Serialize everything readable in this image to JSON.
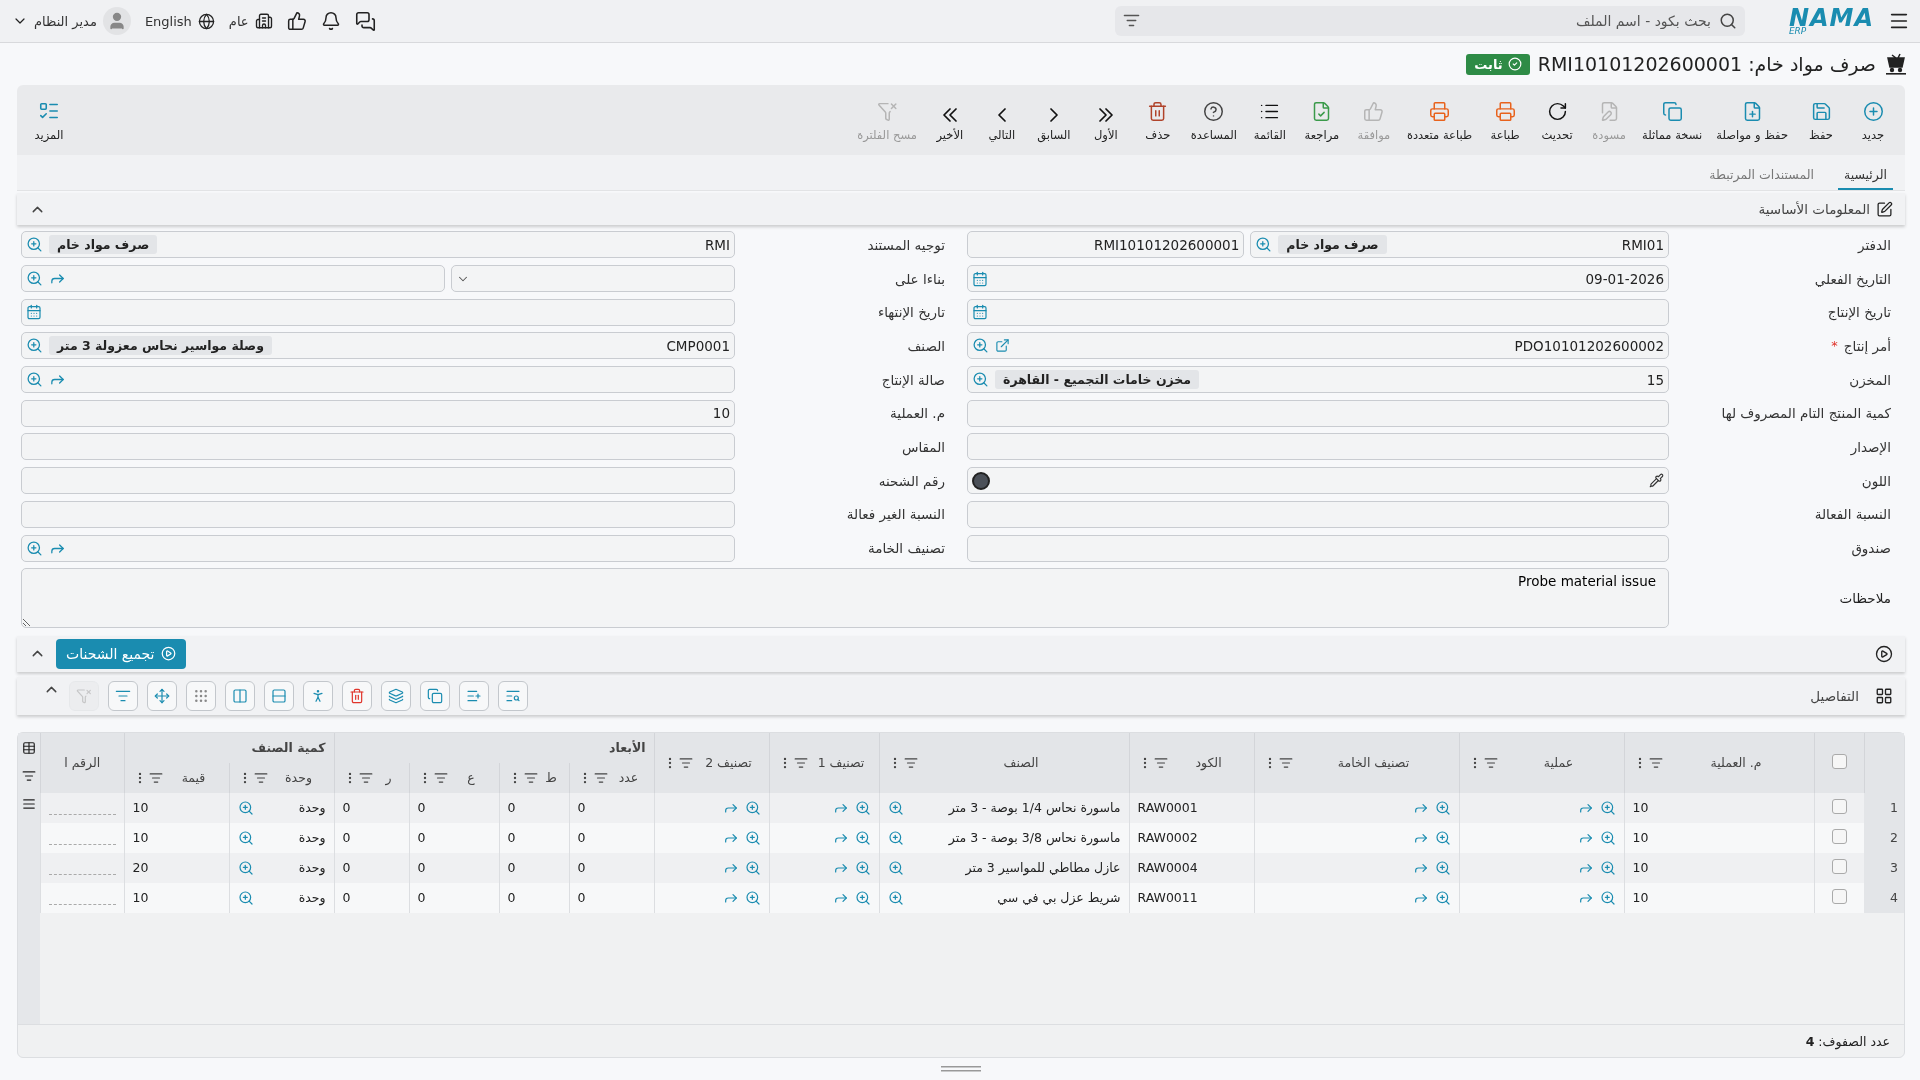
{
  "topbar": {
    "logo": "NAMA",
    "logo_sub": "ERP",
    "search_placeholder": "بحث بكود - اسم الملف",
    "company": "عام",
    "language": "English",
    "user": "مدير النظام"
  },
  "title": {
    "text": "صرف مواد خام: RMI10101202600001",
    "status": "ثابت"
  },
  "toolbar": [
    {
      "label": "جديد",
      "disabled": false
    },
    {
      "label": "حفظ",
      "disabled": false
    },
    {
      "label": "حفظ و مواصلة",
      "disabled": false
    },
    {
      "label": "نسخة مماثلة",
      "disabled": false
    },
    {
      "label": "مسودة",
      "disabled": true
    },
    {
      "label": "تحديث",
      "disabled": false
    },
    {
      "label": "طباعة",
      "disabled": false
    },
    {
      "label": "طباعة متعددة",
      "disabled": false
    },
    {
      "label": "موافقة",
      "disabled": true
    },
    {
      "label": "مراجعة",
      "disabled": false
    },
    {
      "label": "القائمة",
      "disabled": false
    },
    {
      "label": "المساعدة",
      "disabled": false
    },
    {
      "label": "حذف",
      "disabled": false
    },
    {
      "label": "الأول",
      "disabled": false
    },
    {
      "label": "السابق",
      "disabled": false
    },
    {
      "label": "التالي",
      "disabled": false
    },
    {
      "label": "الأخير",
      "disabled": false
    },
    {
      "label": "مسح الفلترة",
      "disabled": true
    }
  ],
  "more": "المزيد",
  "tabs": [
    {
      "label": "الرئيسية",
      "selected": true
    },
    {
      "label": "المستندات المرتبطة",
      "selected": false
    }
  ],
  "section": {
    "title": "المعلومات الأساسية",
    "expanded": true,
    "right": [
      {
        "label": "الدفتر",
        "kind": "book",
        "value": "RMI01",
        "tag": "صرف مواد خام",
        "serial": "RMI10101202600001"
      },
      {
        "label": "التاريخ الفعلي",
        "kind": "date",
        "value": "09-01-2026"
      },
      {
        "label": "تاريخ الإنتاج",
        "kind": "date"
      },
      {
        "label": "أمر إنتاج",
        "kind": "lookup-open",
        "value": "PDO10101202600002",
        "marker": "*"
      },
      {
        "label": "المخزن",
        "kind": "lookup",
        "value": "15",
        "tag": "مخزن خامات التجميع - القاهرة"
      },
      {
        "label": "كمية المنتج التام المصروف لها",
        "kind": "text"
      },
      {
        "label": "الإصدار",
        "kind": "text"
      },
      {
        "label": "اللون",
        "kind": "color",
        "color": "#4b5058"
      },
      {
        "label": "النسبة الفعالة",
        "kind": "text"
      },
      {
        "label": "صندوق",
        "kind": "text"
      }
    ],
    "left": [
      {
        "label": "توجيه المستند",
        "kind": "lookup",
        "value": "RMI",
        "tag": "صرف مواد خام"
      },
      {
        "label": "بناءا على",
        "kind": "dropdown-lookup"
      },
      {
        "label": "تاريخ الإنتهاء",
        "kind": "date"
      },
      {
        "label": "الصنف",
        "kind": "lookup",
        "value": "CMP0001",
        "tag": "وصلة مواسير نحاس معزولة 3 متر"
      },
      {
        "label": "صالة الإنتاج",
        "kind": "lookup-share"
      },
      {
        "label": "م. العملية",
        "kind": "text",
        "value": "10"
      },
      {
        "label": "المقاس",
        "kind": "text"
      },
      {
        "label": "رقم الشحنه",
        "kind": "text"
      },
      {
        "label": "النسبة الغير فعالة",
        "kind": "text"
      },
      {
        "label": "تصنيف الخامة",
        "kind": "lookup-share"
      }
    ],
    "notes": {
      "label": "ملاحظات",
      "value": "Probe material issue"
    }
  },
  "shipments": {
    "button": "تجميع الشحنات",
    "expanded": true
  },
  "details": {
    "title": "التفاصيل",
    "expanded": true,
    "all_selected": false,
    "tools": [
      {
        "disabled": true
      },
      {
        "disabled": false
      },
      {
        "disabled": false
      },
      {
        "disabled": false
      },
      {
        "disabled": false
      },
      {
        "disabled": false
      },
      {
        "disabled": false
      },
      {
        "disabled": false
      },
      {
        "disabled": false
      },
      {
        "disabled": false
      },
      {
        "disabled": false
      },
      {
        "disabled": false
      }
    ],
    "columns": [
      {
        "label": "م. العملية",
        "kind": "text"
      },
      {
        "label": "عملية",
        "kind": "lookup-share"
      },
      {
        "label": "تصنيف الخامة",
        "kind": "lookup-share"
      },
      {
        "label": "الكود",
        "kind": "text"
      },
      {
        "label": "الصنف",
        "kind": "text-lookup"
      },
      {
        "label": "تصنيف 1",
        "kind": "lookup-share"
      },
      {
        "label": "تصنيف 2",
        "kind": "lookup-share"
      },
      {
        "label": "الأبعاد",
        "kind": "group",
        "columns": [
          {
            "label": "عدد",
            "kind": "text"
          },
          {
            "label": "ط",
            "kind": "text"
          },
          {
            "label": "ع",
            "kind": "text"
          },
          {
            "label": "ر",
            "kind": "text"
          }
        ]
      },
      {
        "label": "كمية الصنف",
        "kind": "group",
        "columns": [
          {
            "label": "وحدة",
            "kind": "text-lookup"
          },
          {
            "label": "قيمة",
            "kind": "text"
          }
        ]
      },
      {
        "label": "الرقم ا",
        "kind": "blank"
      }
    ],
    "rows": [
      {
        "number": "1",
        "selected": false,
        "values": [
          "10",
          "RAW0001",
          "ماسورة نحاس 1/4 بوصة - 3 متر",
          "0",
          "0",
          "0",
          "0",
          "وحدة",
          "10"
        ]
      },
      {
        "number": "2",
        "selected": false,
        "values": [
          "10",
          "RAW0002",
          "ماسورة نحاس 3/8 بوصة - 3 متر",
          "0",
          "0",
          "0",
          "0",
          "وحدة",
          "10"
        ]
      },
      {
        "number": "3",
        "selected": false,
        "values": [
          "10",
          "RAW0004",
          "عازل مطاطي للمواسير 3 متر",
          "0",
          "0",
          "0",
          "0",
          "وحدة",
          "20"
        ]
      },
      {
        "number": "4",
        "selected": false,
        "values": [
          "10",
          "RAW0011",
          "شريط عزل بي في سي",
          "0",
          "0",
          "0",
          "0",
          "وحدة",
          "10"
        ]
      }
    ],
    "footer": "عدد الصفوف: **4**"
  }
}
